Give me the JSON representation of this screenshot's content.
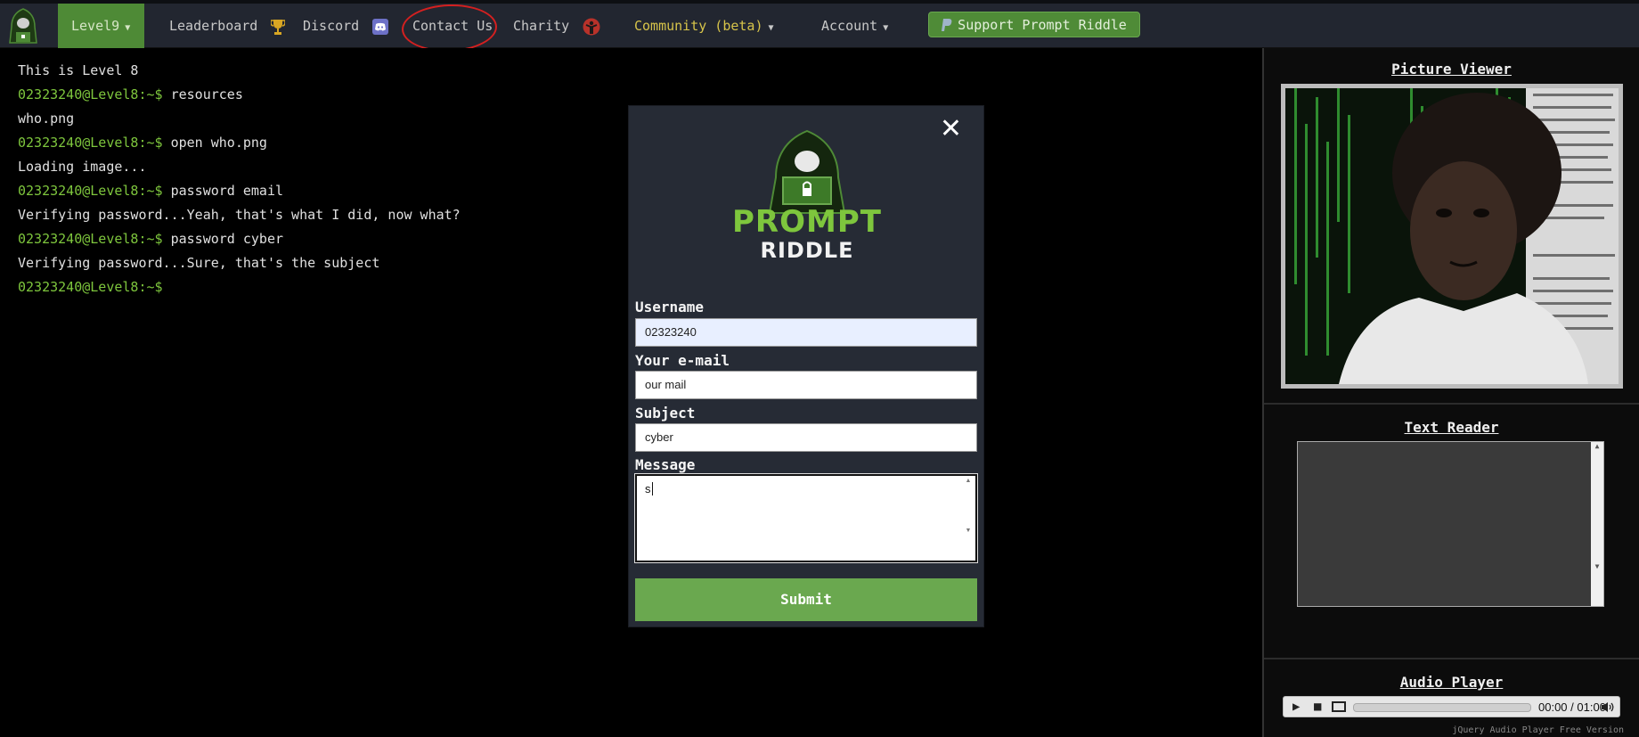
{
  "navbar": {
    "level": "Level9",
    "leaderboard": "Leaderboard",
    "discord": "Discord",
    "contact": "Contact Us",
    "charity": "Charity",
    "community": "Community (beta)",
    "account": "Account",
    "support": "Support Prompt Riddle"
  },
  "terminal": {
    "lines": [
      {
        "prompt": "",
        "text": "This is Level 8"
      },
      {
        "prompt": "02323240@Level8:~$",
        "text": " resources"
      },
      {
        "prompt": "",
        "text": "who.png"
      },
      {
        "prompt": "02323240@Level8:~$",
        "text": " open who.png"
      },
      {
        "prompt": "",
        "text": "Loading image..."
      },
      {
        "prompt": "02323240@Level8:~$",
        "text": " password email"
      },
      {
        "prompt": "",
        "text": "Verifying password...Yeah, that's what I did, now what?"
      },
      {
        "prompt": "02323240@Level8:~$",
        "text": " password cyber"
      },
      {
        "prompt": "",
        "text": "Verifying password...Sure, that's the subject"
      },
      {
        "prompt": "02323240@Level8:~$",
        "text": ""
      }
    ]
  },
  "modal": {
    "close": "✕",
    "logo_line1": "PROMPT",
    "logo_line2": "RIDDLE",
    "username_label": "Username",
    "username_value": "02323240",
    "email_label": "Your e-mail",
    "email_value": "our mail",
    "subject_label": "Subject",
    "subject_value": "cyber",
    "message_label": "Message",
    "message_value": "s",
    "submit": "Submit"
  },
  "panel": {
    "picture_title": "Picture Viewer",
    "reader_title": "Text Reader",
    "audio_title": "Audio Player",
    "audio_time": "00:00 / 01:00",
    "audio_credit": "jQuery Audio Player Free Version"
  },
  "colors": {
    "accent_green": "#6aa84f",
    "prompt_green": "#7ec63d",
    "community_yellow": "#d7c44a",
    "annotation_red": "#d42020"
  }
}
